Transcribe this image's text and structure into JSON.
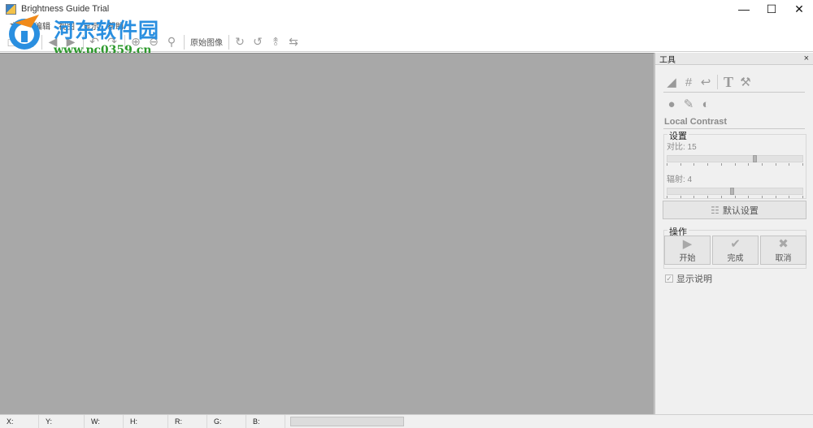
{
  "window": {
    "title": "Brightness Guide Trial",
    "controls": {
      "minimize": "—",
      "maximize": "☐",
      "close": "✕"
    }
  },
  "menu": {
    "items": [
      "文件",
      "编辑",
      "视图",
      "显示",
      "帮助"
    ]
  },
  "watermark": {
    "title": "河东软件园",
    "url": "www.pc0359.cn"
  },
  "toolbar": {
    "original_image_label": "原始图像"
  },
  "panel": {
    "title": "工具",
    "close": "×",
    "section_title": "Local Contrast",
    "settings": {
      "label": "设置",
      "contrast_label": "对比: 15",
      "contrast_value": 0.65,
      "radius_label": "辐射: 4",
      "radius_value": 0.48
    },
    "default_button": "默认设置",
    "operations": {
      "label": "操作",
      "start": "开始",
      "finish": "完成",
      "cancel": "取消"
    },
    "show_help": "显示说明"
  },
  "status": {
    "x": "X:",
    "y": "Y:",
    "w": "W:",
    "h": "H:",
    "r": "R:",
    "g": "G:",
    "b": "B:"
  }
}
